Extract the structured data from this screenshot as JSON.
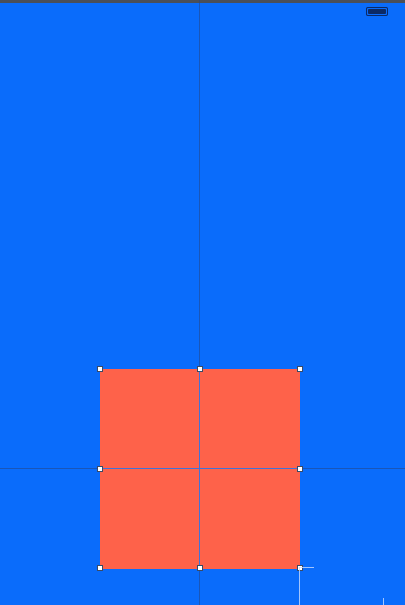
{
  "canvas": {
    "background_color": "#0a6cfb",
    "status_icon": "battery-icon"
  },
  "selected_shape": {
    "kind": "rectangle",
    "fill_color": "#fe624a",
    "selected": true,
    "handle_color": "#ffffff"
  },
  "guides": {
    "color": "#3f72d9"
  }
}
